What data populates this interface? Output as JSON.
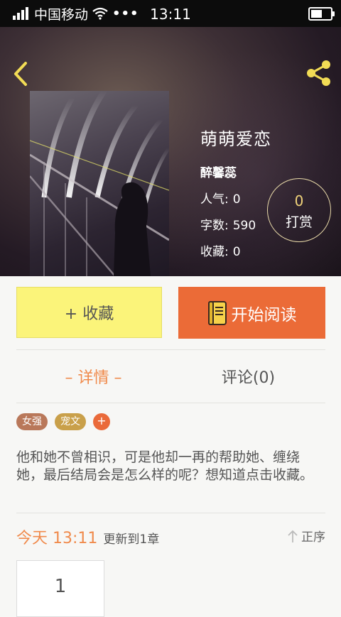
{
  "status_bar": {
    "carrier": "中国移动",
    "dots": "•••",
    "time": "13:11",
    "battery_level": 0.7
  },
  "book": {
    "title": "萌萌爱恋",
    "author": "醉馨蕊",
    "stats": [
      {
        "label": "人气:",
        "value": "0"
      },
      {
        "label": "字数:",
        "value": "590"
      },
      {
        "label": "收藏:",
        "value": "0"
      }
    ],
    "tip": {
      "count": "0",
      "label": "打赏"
    }
  },
  "actions": {
    "favorite": "+ 收藏",
    "start_reading": "开始阅读"
  },
  "tabs": {
    "detail": "– 详情 –",
    "comments": "评论(0)"
  },
  "tags": [
    {
      "label": "女强",
      "color": "#b9785a"
    },
    {
      "label": "宠文",
      "color": "#c9a04a"
    }
  ],
  "tag_add": "+",
  "description": "他和她不曾相识，可是他却一再的帮助她、缠绕她，最后结局会是怎么样的呢？想知道点击收藏。",
  "update": {
    "time": "今天 13:11",
    "text": "更新到1章"
  },
  "sort_label": "正序",
  "chapters": [
    "1"
  ],
  "colors": {
    "accent_orange": "#eb6b37",
    "favorite_yellow": "#fbf47a",
    "tab_active": "#f08a4b",
    "icon_yellow": "#f2dc55"
  }
}
